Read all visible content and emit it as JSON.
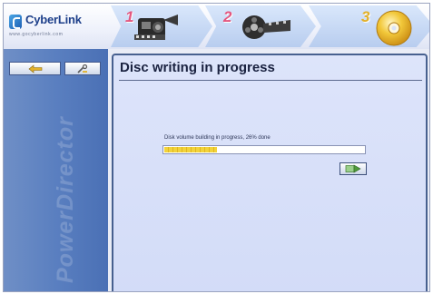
{
  "header": {
    "brand": "CyberLink",
    "brand_url": "www.gocyberlink.com",
    "steps": [
      {
        "number": "1",
        "icon": "film-capture-icon"
      },
      {
        "number": "2",
        "icon": "film-reel-icon"
      },
      {
        "number": "3",
        "icon": "disc-icon"
      }
    ]
  },
  "sidebar": {
    "back_icon": "back-arrow-icon",
    "tools_icon": "tools-icon",
    "watermark": "PowerDirector"
  },
  "main": {
    "title": "Disc writing in progress",
    "status": "Disk volume building in progress, 26% done",
    "progress_fraction": 0.26,
    "action_icon": "go-arrow-icon"
  },
  "colors": {
    "step_number": "#e4577f",
    "progress_fill": "#f2d33a",
    "sidebar": "#5a7fc0",
    "panel": "#d9e1f9"
  }
}
